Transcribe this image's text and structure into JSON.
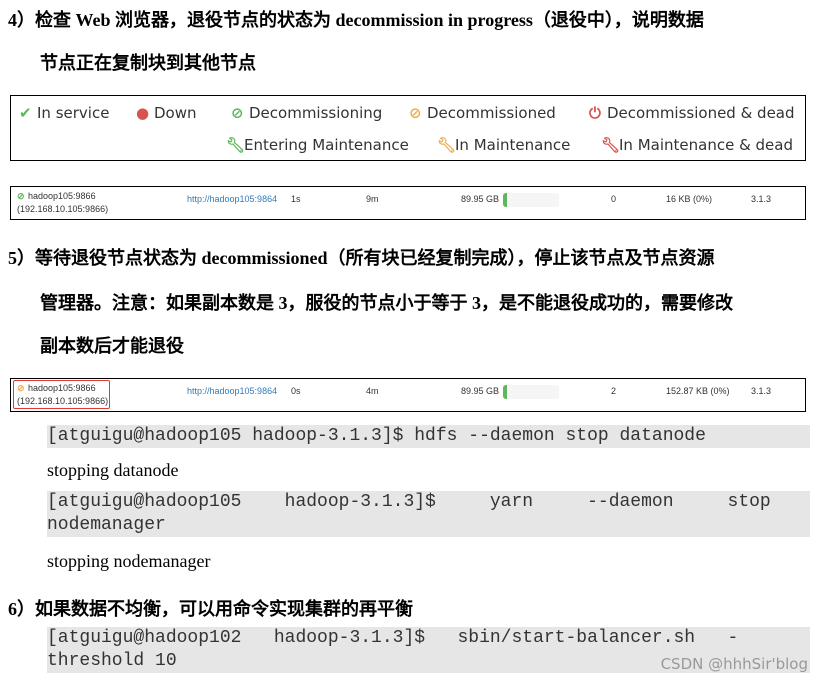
{
  "step4": {
    "line1": "4）检查 Web 浏览器，退役节点的状态为 decommission in progress（退役中），说明数据",
    "line2": "节点正在复制块到其他节点"
  },
  "legend": [
    {
      "icon": "check-icon",
      "glyph": "✔",
      "color": "#5cb85c",
      "label": "In service"
    },
    {
      "icon": "down-icon",
      "glyph": "●",
      "color": "#d9534f",
      "label": "Down"
    },
    {
      "icon": "decommissioning-icon",
      "glyph": "⊘",
      "color": "#5cb85c",
      "label": "Decommissioning"
    },
    {
      "icon": "decommissioned-icon",
      "glyph": "⊘",
      "color": "#f0ad4e",
      "label": "Decommissioned"
    },
    {
      "icon": "power-icon",
      "glyph": "⏻",
      "color": "#d9534f",
      "label": "Decommissioned & dead"
    },
    {
      "icon": "wrench-icon",
      "glyph": "🔧︎",
      "color": "#5cb85c",
      "label": "Entering Maintenance"
    },
    {
      "icon": "wrench-icon",
      "glyph": "🔧︎",
      "color": "#f0ad4e",
      "label": "In Maintenance"
    },
    {
      "icon": "wrench-icon",
      "glyph": "🔧︎",
      "color": "#d9534f",
      "label": "In Maintenance & dead"
    }
  ],
  "rows": [
    {
      "icon_color": "#5cb85c",
      "node": "hadoop105:9866",
      "addr": "(192.168.10.105:9866)",
      "http": "http://hadoop105:9864",
      "last_contact": "1s",
      "last_block": "9m",
      "capacity": "89.95 GB",
      "used_pct": 8,
      "blocks": "0",
      "block_pool": "16 KB (0%)",
      "version": "3.1.3"
    },
    {
      "icon_color": "#f0ad4e",
      "node": "hadoop105:9866",
      "addr": "(192.168.10.105:9866)",
      "http": "http://hadoop105:9864",
      "last_contact": "0s",
      "last_block": "4m",
      "capacity": "89.95 GB",
      "used_pct": 8,
      "blocks": "2",
      "block_pool": "152.87 KB (0%)",
      "version": "3.1.3"
    }
  ],
  "step5": {
    "line1": "5）等待退役节点状态为 decommissioned（所有块已经复制完成），停止该节点及节点资源",
    "line2": "管理器。注意：如果副本数是 3，服役的节点小于等于 3，是不能退役成功的，需要修改",
    "line3": "副本数后才能退役"
  },
  "code1": "[atguigu@hadoop105 hadoop-3.1.3]$ hdfs --daemon stop datanode",
  "out1": "stopping datanode",
  "code2": "[atguigu@hadoop105    hadoop-3.1.3]$     yarn     --daemon     stop\nnodemanager",
  "out2": "stopping nodemanager",
  "step6": "6）如果数据不均衡，可以用命令实现集群的再平衡",
  "code3": "[atguigu@hadoop102   hadoop-3.1.3]$   sbin/start-balancer.sh   -\nthreshold 10",
  "watermark": "CSDN @hhhSir'blog"
}
